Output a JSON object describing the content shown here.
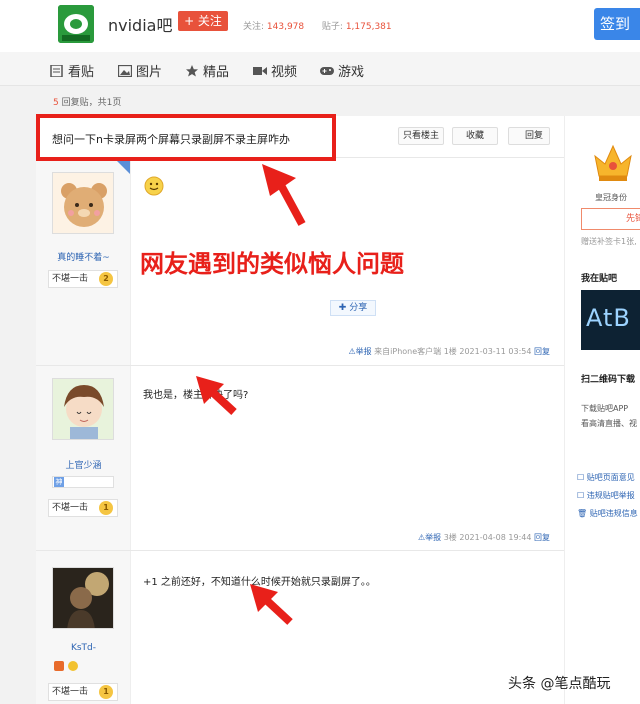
{
  "header": {
    "logo_icon": "nvidia-bar-logo",
    "bar_name": "nvidia吧",
    "follow_label": "+ 关注",
    "follow_count_label": "关注:",
    "follow_count": "143,978",
    "post_count_label": "贴子:",
    "post_count": "1,175,381",
    "signin_label": "签到"
  },
  "nav": {
    "items": [
      {
        "label": "看贴",
        "icon": "document-icon"
      },
      {
        "label": "图片",
        "icon": "image-icon"
      },
      {
        "label": "精品",
        "icon": "star-icon"
      },
      {
        "label": "视频",
        "icon": "video-icon"
      },
      {
        "label": "游戏",
        "icon": "gamepad-icon"
      }
    ]
  },
  "reply_info": {
    "count": "5",
    "text": "回复贴，共1页"
  },
  "thread": {
    "title": "想问一下n卡录屏两个屏幕只录副屏不录主屏咋办",
    "buttons": {
      "only_op": "只看楼主",
      "favorite": "收藏",
      "reply": "回复"
    }
  },
  "annotation": "网友遇到的类似恼人问题",
  "posts": [
    {
      "author": "真的睡不着~",
      "level_title": "不堪一击",
      "level_num": "2",
      "content": "",
      "emoji": "smile-emoji",
      "share_label": "分享",
      "report_label": "举报",
      "source": "来自iPhone客户端",
      "floor": "1楼",
      "time": "2021-03-11 03:54",
      "reply_label": "回复"
    },
    {
      "author": "上官少涵",
      "level_title": "不堪一击",
      "level_num": "1",
      "badge": "神",
      "content": "我也是，楼主解决了吗?",
      "report_label": "举报",
      "floor": "3楼",
      "time": "2021-04-08 19:44",
      "reply_label": "回复"
    },
    {
      "author": "KsTd-",
      "level_title": "不堪一击",
      "level_num": "1",
      "content": "+1 之前还好，不知道什么时候开始就只录副屏了。。"
    }
  ],
  "sidebar": {
    "crown_label": "皇冠身份",
    "button_label": "先锋",
    "promo_text": "赠送补签卡1张,",
    "my_bars_title": "我在贴吧",
    "my_bar_logo": "AtB",
    "qr_title": "扫二维码下载",
    "download_text": "下载贴吧APP",
    "download_sub": "看高清直播、视",
    "links": [
      "贴吧页面意见",
      "违规贴吧举报",
      "贴吧违规信息"
    ]
  },
  "watermark": "头条 @笔点酷玩",
  "colors": {
    "accent_red": "#e8201a",
    "link_blue": "#2d64b3",
    "signin_blue": "#3a86e8"
  }
}
